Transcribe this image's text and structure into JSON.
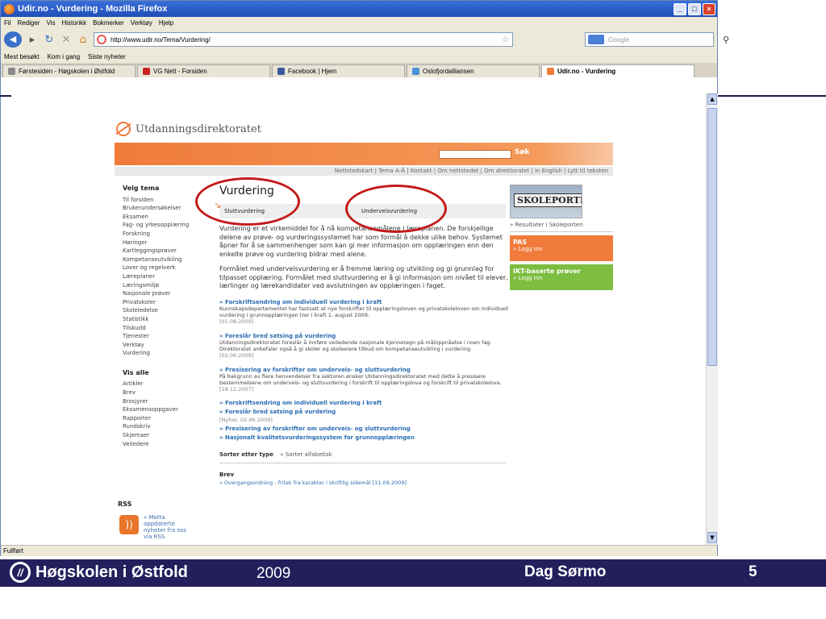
{
  "window": {
    "title": "Udir.no - Vurdering - Mozilla Firefox",
    "menu": [
      "Fil",
      "Rediger",
      "Vis",
      "Historikk",
      "Bokmerker",
      "Verktøy",
      "Hjelp"
    ],
    "url": "http://www.udir.no/Tema/Vurdering/",
    "search_placeholder": "Google",
    "bookmarks": [
      "Mest besøkt",
      "Kom i gang",
      "Siste nyheter"
    ],
    "tabs": [
      {
        "label": "Førstesiden - Høgskolen i Østfold",
        "color": "#888888"
      },
      {
        "label": "VG Nett - Forsiden",
        "color": "#cc2222"
      },
      {
        "label": "Facebook | Hjem",
        "color": "#3b5998"
      },
      {
        "label": "Oslofjordalliansen",
        "color": "#4a90d9"
      },
      {
        "label": "Udir.no - Vurdering",
        "color": "#f07b3a"
      }
    ],
    "status": "Fullført"
  },
  "page": {
    "logo_text": "Utdanningsdirektoratet",
    "search_button": "Søk",
    "topnav": "Nettstedskart  |  Tema A-Å  |  Kontakt  |  Om nettstedet  |  Om direktoratet  |  In English  |  Lytt til teksten",
    "left_heading": "Velg tema",
    "left_items": [
      "Til forsiden",
      "Brukerundersøkelser",
      "Eksamen",
      "Fag- og yrkesopplæring",
      "Forskning",
      "Høringer",
      "Kartleggingsprøver",
      "Kompetanseutvikling",
      "Lover og regelverk",
      "Læreplaner",
      "Læringsmiljø",
      "Nasjonale prøver",
      "Privatskoler",
      "Skoleledelse",
      "Statistikk",
      "Tilskudd",
      "Tjenester",
      "Verktøy",
      "Vurdering"
    ],
    "left_heading2": "Vis alle",
    "left_items2": [
      "Artikler",
      "Brev",
      "Brosjyrer",
      "Eksamensoppgaver",
      "Rapporter",
      "Rundskriv",
      "Skjemaer",
      "Veiledere"
    ],
    "rss_heading": "RSS",
    "rss_text": "» Motta oppdaterte nyheter fra oss via RSS",
    "title": "Vurdering",
    "tab_slutt": "Sluttvurdering",
    "tab_underveis": "Underveisvurdering",
    "para1": "Vurdering er et virkemiddel for å nå kompetansemålene i læreplanen. De forskjellige delene av prøve- og vurderingssystemet har som formål å dekke ulike behov. Systemet åpner for å se sammenhenger som kan gi mer informasjon om opplæringen enn den enkelte prøve og vurdering bidrar med alene.",
    "para2": "Formålet med underveisvurdering er å fremme læring og utvikling og gi grunnlag for tilpasset opplæring. Formålet med sluttvurdering er å gi informasjon om nivået til elever, lærlinger og lærekandidater ved avslutningen av opplæringen i faget.",
    "news": [
      {
        "title": "» Forskriftsendring om individuell vurdering i kraft",
        "text": "Kunnskapsdepartementet har fastsatt at nye forskrifter til opplæringsloven og privatskoleloven om individuell vurdering i grunnopplæringen trer i kraft 1. august 2009.",
        "date": "[01.08.2009]"
      },
      {
        "title": "» Foreslår bred satsing på vurdering",
        "text": "Utdanningsdirektoratet foreslår å innføre veiledende nasjonale kjennetegn på måloppnåelse i noen fag. Direktoratet anbefaler også å gi skoler og skoleeiere tilbud om kompetanseutvikling i vurdering.",
        "date": "[02.06.2009]"
      },
      {
        "title": "» Presisering av forskrifter om underveis- og sluttvurdering",
        "text": "På bakgrunn av flere henvendelser fra sektoren ønsker Utdanningsdirektoratet med dette å presisere bestemmelsene om underveis- og sluttvurdering i forskrift til opplæringslova og forskrift til privatskolelova.",
        "date": "[18.12.2007]"
      }
    ],
    "news_links": [
      {
        "title": "» Forskriftsendring om individuell vurdering i kraft",
        "sub": ""
      },
      {
        "title": "» Foreslår bred satsing på vurdering",
        "sub": "[Nyhet, 02.06.2009]"
      },
      {
        "title": "» Presisering av forskrifter om underveis- og sluttvurdering",
        "sub": ""
      },
      {
        "title": "» Nasjonalt kvalitetsvurderingssystem for grunnopplæringen",
        "sub": ""
      }
    ],
    "sort_label": "Sorter etter type",
    "sort_alt": "» Sorter alfabetisk",
    "brev_heading": "Brev",
    "brev_item": "» Overgangsordning - fritak fra karakter i skriftlig sidemål [11.09.2009]",
    "skoleporten_sign": "SKOLEPORTEN",
    "skoleporten_link": "» Resultater i Skoleporten",
    "pas_title": "PAS",
    "pas_link": "» Logg inn",
    "ikt_title": "IKT-baserte prøver",
    "ikt_link": "» Logg inn"
  },
  "footer": {
    "org": "Høgskolen i Østfold",
    "year": "2009",
    "author": "Dag Sørmo",
    "slide_number": "5"
  }
}
